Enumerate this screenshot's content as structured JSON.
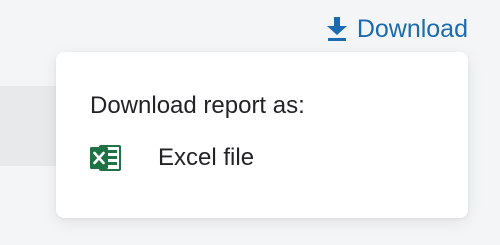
{
  "header": {
    "download_label": "Download",
    "download_icon": "download-arrow-icon"
  },
  "popover": {
    "title": "Download report as:",
    "options": [
      {
        "label": "Excel file",
        "icon": "excel-icon"
      }
    ]
  },
  "colors": {
    "accent": "#1c6ab0",
    "excel_green": "#1f7244",
    "text": "#222326",
    "background": "#f4f5f6",
    "popover_bg": "#ffffff"
  }
}
